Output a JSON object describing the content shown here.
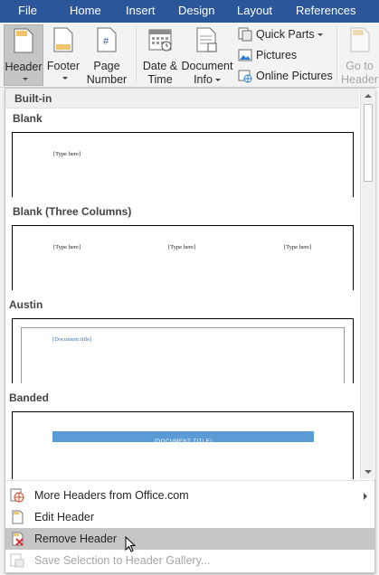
{
  "tabs": [
    {
      "label": "File"
    },
    {
      "label": "Home"
    },
    {
      "label": "Insert"
    },
    {
      "label": "Design"
    },
    {
      "label": "Layout"
    },
    {
      "label": "References"
    }
  ],
  "ribbon": {
    "header": {
      "label": "Header"
    },
    "footer": {
      "label": "Footer"
    },
    "page_number": {
      "line1": "Page",
      "line2": "Number"
    },
    "date_time": {
      "line1": "Date &",
      "line2": "Time"
    },
    "document_info": {
      "line1": "Document",
      "line2": "Info"
    },
    "quick_parts": {
      "label": "Quick Parts"
    },
    "pictures": {
      "label": "Pictures"
    },
    "online_pictures": {
      "label": "Online Pictures"
    },
    "go_to_header": {
      "line1": "Go to",
      "line2": "Header"
    }
  },
  "gallery": {
    "category": "Built-in",
    "items": [
      {
        "name": "Blank",
        "placeholders": [
          "[Type here]"
        ]
      },
      {
        "name": "Blank (Three Columns)",
        "placeholders": [
          "[Type here]",
          "[Type here]",
          "[Type here]"
        ]
      },
      {
        "name": "Austin",
        "placeholders": [
          "[Document title]"
        ]
      },
      {
        "name": "Banded",
        "placeholders": [
          "[DOCUMENT TITLE]"
        ]
      }
    ]
  },
  "menu": {
    "more_headers": "More Headers from Office.com",
    "edit_header": "Edit Header",
    "remove_header": "Remove Header",
    "save_selection": "Save Selection to Header Gallery..."
  },
  "colors": {
    "ribbon_tab_bar": "#2b579a",
    "banded_bar": "#5b9bd5",
    "hover_highlight": "#c6c6c6"
  }
}
